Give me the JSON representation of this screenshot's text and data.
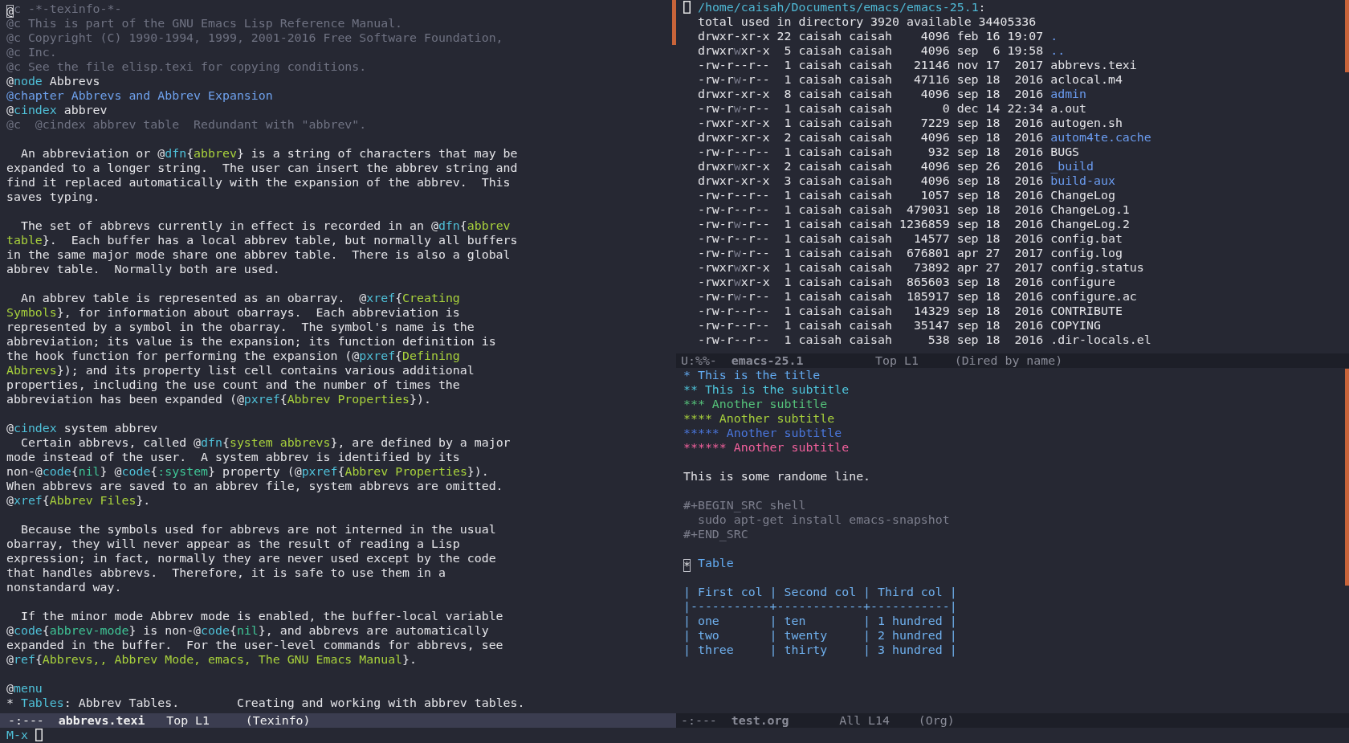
{
  "left_window": {
    "buffer": {
      "blocks": [
        [
          [
            {
              "kind": "cursor",
              "text": "@"
            },
            {
              "kind": "comment",
              "text": "c -*-texinfo-*-"
            }
          ],
          [
            {
              "kind": "comment",
              "text": "@c This is part of the GNU Emacs Lisp Reference Manual."
            }
          ],
          [
            {
              "kind": "comment",
              "text": "@c Copyright (C) 1990-1994, 1999, 2001-2016 Free Software Foundation,"
            }
          ],
          [
            {
              "kind": "comment",
              "text": "@c Inc."
            }
          ],
          [
            {
              "kind": "comment",
              "text": "@c See the file elisp.texi for copying conditions."
            }
          ],
          [
            "@",
            {
              "kind": "cmd",
              "text": "node"
            },
            " Abbrevs"
          ],
          [
            {
              "kind": "chapter",
              "text": "@chapter Abbrevs and Abbrev Expansion"
            }
          ],
          [
            "@",
            {
              "kind": "cmd",
              "text": "cindex"
            },
            " abbrev"
          ],
          [
            {
              "kind": "comment",
              "text": "@c  @cindex abbrev table  Redundant with \"abbrev\"."
            }
          ]
        ],
        [
          [
            "  An abbreviation or @",
            {
              "kind": "cmd",
              "text": "dfn"
            },
            "{",
            {
              "kind": "arg",
              "text": "abbrev"
            },
            "} is a string of characters that may be"
          ],
          "expanded to a longer string.  The user can insert the abbrev string and",
          "find it replaced automatically with the expansion of the abbrev.  This",
          "saves typing."
        ],
        [
          [
            "  The set of abbrevs currently in effect is recorded in an @",
            {
              "kind": "cmd",
              "text": "dfn"
            },
            "{",
            {
              "kind": "arg",
              "text": "abbrev"
            }
          ],
          [
            {
              "kind": "arg",
              "text": "table"
            },
            "}.  Each buffer has a local abbrev table, but normally all buffers"
          ],
          "in the same major mode share one abbrev table.  There is also a global",
          "abbrev table.  Normally both are used."
        ],
        [
          [
            "  An abbrev table is represented as an obarray.  @",
            {
              "kind": "cmd",
              "text": "xref"
            },
            "{",
            {
              "kind": "arg",
              "text": "Creating"
            }
          ],
          [
            {
              "kind": "arg",
              "text": "Symbols"
            },
            "}, for information about obarrays.  Each abbreviation is"
          ],
          "represented by a symbol in the obarray.  The symbol's name is the",
          "abbreviation; its value is the expansion; its function definition is",
          [
            "the hook function for performing the expansion (@",
            {
              "kind": "cmd",
              "text": "pxref"
            },
            "{",
            {
              "kind": "arg",
              "text": "Defining"
            }
          ],
          [
            {
              "kind": "arg",
              "text": "Abbrevs"
            },
            "}); and its property list cell contains various additional"
          ],
          "properties, including the use count and the number of times the",
          [
            "abbreviation has been expanded (@",
            {
              "kind": "cmd",
              "text": "pxref"
            },
            "{",
            {
              "kind": "arg",
              "text": "Abbrev Properties"
            },
            "})."
          ]
        ],
        [
          [
            "@",
            {
              "kind": "cmd",
              "text": "cindex"
            },
            " system abbrev"
          ],
          [
            "  Certain abbrevs, called @",
            {
              "kind": "cmd",
              "text": "dfn"
            },
            "{",
            {
              "kind": "arg",
              "text": "system abbrevs"
            },
            "}, are defined by a major"
          ],
          "mode instead of the user.  A system abbrev is identified by its",
          [
            "non-@",
            {
              "kind": "cmd",
              "text": "code"
            },
            "{",
            {
              "kind": "code",
              "text": "nil"
            },
            "} @",
            {
              "kind": "cmd",
              "text": "code"
            },
            "{",
            {
              "kind": "code",
              "text": ":system"
            },
            "} property (@",
            {
              "kind": "cmd",
              "text": "pxref"
            },
            "{",
            {
              "kind": "arg",
              "text": "Abbrev Properties"
            },
            "})."
          ],
          "When abbrevs are saved to an abbrev file, system abbrevs are omitted.",
          [
            "@",
            {
              "kind": "cmd",
              "text": "xref"
            },
            "{",
            {
              "kind": "arg",
              "text": "Abbrev Files"
            },
            "}."
          ]
        ],
        [
          "  Because the symbols used for abbrevs are not interned in the usual",
          "obarray, they will never appear as the result of reading a Lisp",
          "expression; in fact, normally they are never used except by the code",
          "that handles abbrevs.  Therefore, it is safe to use them in a",
          "nonstandard way."
        ],
        [
          "  If the minor mode Abbrev mode is enabled, the buffer-local variable",
          [
            "@",
            {
              "kind": "cmd",
              "text": "code"
            },
            "{",
            {
              "kind": "code",
              "text": "abbrev-mode"
            },
            "} is non-@",
            {
              "kind": "cmd",
              "text": "code"
            },
            "{",
            {
              "kind": "code",
              "text": "nil"
            },
            "}, and abbrevs are automatically"
          ],
          "expanded in the buffer.  For the user-level commands for abbrevs, see",
          [
            "@",
            {
              "kind": "cmd",
              "text": "ref"
            },
            "{",
            {
              "kind": "arg",
              "text": "Abbrevs,, Abbrev Mode, emacs, The GNU Emacs Manual"
            },
            "}."
          ]
        ],
        [
          [
            "@",
            {
              "kind": "cmd",
              "text": "menu"
            }
          ],
          [
            "* ",
            {
              "kind": "cmd",
              "text": "Tables"
            },
            ": Abbrev Tables.        Creating and working with abbrev tables."
          ]
        ]
      ]
    },
    "mode_line": {
      "active": true,
      "segments": [
        "-:---  ",
        {
          "kind": "buffer",
          "text": "abbrevs.texi"
        },
        "   Top L1     (Texinfo)"
      ]
    }
  },
  "right_top_window": {
    "buffer": {
      "blocks": [
        [
          [
            {
              "kind": "cursor_box"
            },
            {
              "kind": "path",
              "text": " /home/caisah/Documents/emacs/emacs-25.1"
            },
            ":"
          ],
          "  total used in directory 3920 available 34405336",
          [
            "  drwxr-xr-x 22 caisah caisah    4096 feb 16 19:07 ",
            {
              "kind": "dir",
              "text": "."
            }
          ],
          [
            "  drwxr",
            {
              "kind": "dim",
              "text": "w"
            },
            "xr-x  5 caisah caisah    4096 sep  6 19:58 ",
            {
              "kind": "dir",
              "text": ".."
            }
          ],
          "  -rw-r--r--  1 caisah caisah   21146 nov 17  2017 abbrevs.texi",
          [
            "  -rw-r",
            {
              "kind": "dim",
              "text": "w"
            },
            "-r--  1 caisah caisah   47116 sep 18  2016 aclocal.m4"
          ],
          [
            "  drwxr-xr-x  8 caisah caisah    4096 sep 18  2016 ",
            {
              "kind": "dir",
              "text": "admin"
            }
          ],
          [
            "  -rw-r",
            {
              "kind": "dim",
              "text": "w"
            },
            "-r--  1 caisah caisah       0 dec 14 22:34 a.out"
          ],
          "  -rwxr-xr-x  1 caisah caisah    7229 sep 18  2016 autogen.sh",
          [
            "  drwxr-xr-x  2 caisah caisah    4096 sep 18  2016 ",
            {
              "kind": "dir",
              "text": "autom4te.cache"
            }
          ],
          "  -rw-r--r--  1 caisah caisah     932 sep 18  2016 BUGS",
          [
            "  drwxr",
            {
              "kind": "dim",
              "text": "w"
            },
            "xr-x  2 caisah caisah    4096 sep 26  2016 ",
            {
              "kind": "dir",
              "text": "_build"
            }
          ],
          [
            "  drwxr-xr-x  3 caisah caisah    4096 sep 18  2016 ",
            {
              "kind": "dir",
              "text": "build-aux"
            }
          ],
          "  -rw-r--r--  1 caisah caisah    1057 sep 18  2016 ChangeLog",
          "  -rw-r--r--  1 caisah caisah  479031 sep 18  2016 ChangeLog.1",
          [
            "  -rw-r",
            {
              "kind": "dim",
              "text": "w"
            },
            "-r--  1 caisah caisah 1236859 sep 18  2016 ChangeLog.2"
          ],
          "  -rw-r--r--  1 caisah caisah   14577 sep 18  2016 config.bat",
          [
            "  -rw-r",
            {
              "kind": "dim",
              "text": "w"
            },
            "-r--  1 caisah caisah  676801 apr 27  2017 config.log"
          ],
          [
            "  -rwxr",
            {
              "kind": "dim",
              "text": "w"
            },
            "xr-x  1 caisah caisah   73892 apr 27  2017 config.status"
          ],
          [
            "  -rwxr",
            {
              "kind": "dim",
              "text": "w"
            },
            "xr-x  1 caisah caisah  865603 sep 18  2016 configure"
          ],
          [
            "  -rw-r",
            {
              "kind": "dim",
              "text": "w"
            },
            "-r--  1 caisah caisah  185917 sep 18  2016 configure.ac"
          ],
          "  -rw-r--r--  1 caisah caisah   14329 sep 18  2016 CONTRIBUTE",
          "  -rw-r--r--  1 caisah caisah   35147 sep 18  2016 COPYING",
          "  -rw-r--r--  1 caisah caisah     538 sep 18  2016 .dir-locals.el"
        ]
      ]
    },
    "mode_line": {
      "active": false,
      "segments": [
        "U:%%-  ",
        {
          "kind": "buffer",
          "text": "emacs-25.1"
        },
        "          Top L1     (Dired by name)"
      ]
    }
  },
  "right_bottom_window": {
    "buffer": {
      "blocks": [
        [
          [
            {
              "kind": "h1",
              "text": "* This is the title"
            }
          ],
          [
            {
              "kind": "h2",
              "text": "** This is the subtitle"
            }
          ],
          [
            {
              "kind": "h3",
              "text": "*** Another subtitle"
            }
          ],
          [
            {
              "kind": "h4",
              "text": "**** Another subtitle"
            }
          ],
          [
            {
              "kind": "h5",
              "text": "***** Another subtitle"
            }
          ],
          [
            {
              "kind": "h6",
              "text": "****** Another subtitle"
            }
          ]
        ],
        [
          "This is some randome line."
        ],
        [
          [
            {
              "kind": "meta",
              "text": "#+BEGIN_SRC shell"
            }
          ],
          [
            {
              "kind": "meta",
              "text": "  sudo apt-get install emacs-snapshot"
            }
          ],
          [
            {
              "kind": "meta",
              "text": "#+END_SRC"
            }
          ]
        ],
        [
          [
            {
              "kind": "cursor",
              "text": "*"
            },
            {
              "kind": "h1",
              "text": " Table"
            }
          ]
        ],
        [
          [
            {
              "kind": "table",
              "text": "| First col | Second col | Third col |"
            }
          ],
          [
            {
              "kind": "table",
              "text": "|-----------+------------+-----------|"
            }
          ],
          [
            {
              "kind": "table",
              "text": "| one       | ten        | 1 hundred |"
            }
          ],
          [
            {
              "kind": "table",
              "text": "| two       | twenty     | 2 hundred |"
            }
          ],
          [
            {
              "kind": "table",
              "text": "| three     | thirty     | 3 hundred |"
            }
          ]
        ]
      ]
    },
    "mode_line": {
      "active": false,
      "segments": [
        "-:---  ",
        {
          "kind": "buffer",
          "text": "test.org"
        },
        "       All L14    (Org)"
      ]
    }
  },
  "minibuffer": {
    "segments": [
      {
        "kind": "prompt",
        "text": "M-x"
      },
      {
        "kind": "cursor_box"
      }
    ]
  }
}
